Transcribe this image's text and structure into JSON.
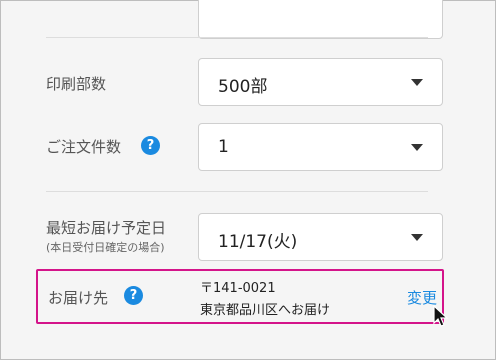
{
  "form": {
    "print_count": {
      "label": "印刷部数",
      "value": "500部"
    },
    "note_count": {
      "label": "ご注文件数",
      "value": "1",
      "help": "?"
    },
    "delivery_date": {
      "label": "最短お届け予定日",
      "sublabel": "(本日受付日確定の場合)",
      "value": "11/17(火)"
    },
    "delivery_dest": {
      "label": "お届け先",
      "help": "?",
      "postal": "〒141-0021",
      "address": "東京都品川区へお届け",
      "change_label": "変更"
    }
  },
  "colors": {
    "accent": "#1a8ae0",
    "highlight": "#d4148a"
  },
  "icons": {
    "help": "question-circle-icon",
    "caret": "chevron-down-icon",
    "cursor": "mouse-pointer-icon"
  }
}
